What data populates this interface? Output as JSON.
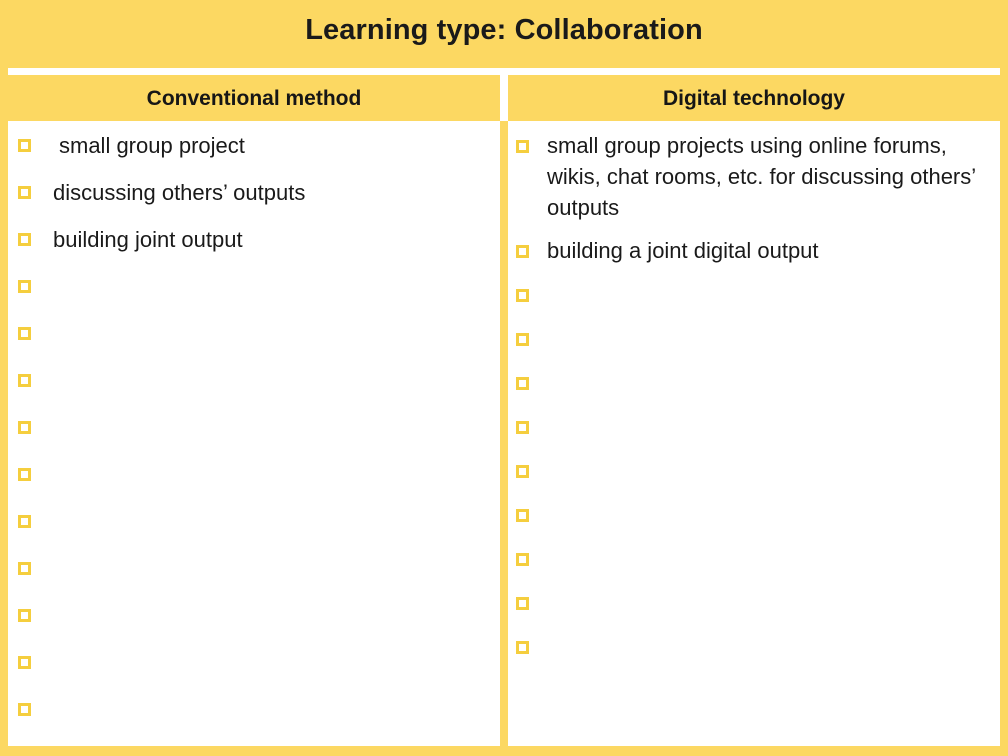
{
  "slide": {
    "title": "Learning type: Collaboration",
    "background_color": "#FCD862",
    "bullet_color": "#F5CE3E",
    "text_color": "#1A1A1A"
  },
  "table": {
    "columns": [
      {
        "header": "Conventional method",
        "items": [
          "small group project",
          "discussing others’ outputs",
          "building joint output",
          "",
          "",
          "",
          "",
          "",
          "",
          "",
          "",
          "",
          ""
        ]
      },
      {
        "header": "Digital technology",
        "items": [
          "small group projects using online forums, wikis, chat rooms, etc. for discussing others’ outputs",
          "building a joint digital output",
          "",
          "",
          "",
          "",
          "",
          "",
          "",
          "",
          ""
        ]
      }
    ]
  }
}
